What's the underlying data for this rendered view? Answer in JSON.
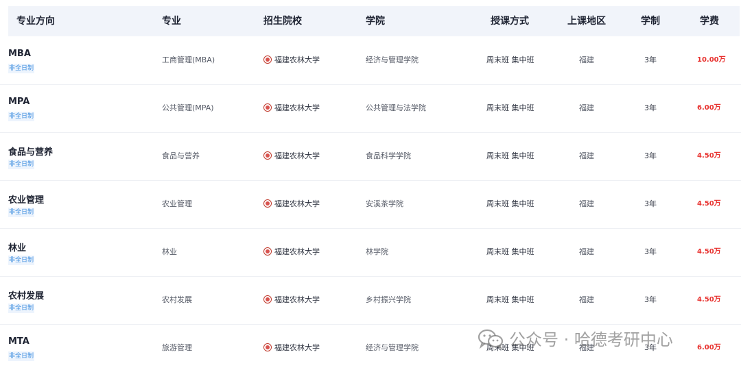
{
  "header": {
    "direction": "专业方向",
    "major": "专业",
    "school": "招生院校",
    "college": "学院",
    "mode": "授课方式",
    "region": "上课地区",
    "years": "学制",
    "fee": "学费"
  },
  "rows": [
    {
      "direction": "MBA",
      "tag": "非全日制",
      "major": "工商管理(MBA)",
      "school": "福建农林大学",
      "college": "经济与管理学院",
      "mode": "周末班 集中班",
      "region": "福建",
      "years": "3年",
      "fee": "10.00万"
    },
    {
      "direction": "MPA",
      "tag": "非全日制",
      "major": "公共管理(MPA)",
      "school": "福建农林大学",
      "college": "公共管理与法学院",
      "mode": "周末班 集中班",
      "region": "福建",
      "years": "3年",
      "fee": "6.00万"
    },
    {
      "direction": "食品与营养",
      "tag": "非全日制",
      "major": "食品与营养",
      "school": "福建农林大学",
      "college": "食品科学学院",
      "mode": "周末班 集中班",
      "region": "福建",
      "years": "3年",
      "fee": "4.50万"
    },
    {
      "direction": "农业管理",
      "tag": "非全日制",
      "major": "农业管理",
      "school": "福建农林大学",
      "college": "安溪茶学院",
      "mode": "周末班 集中班",
      "region": "福建",
      "years": "3年",
      "fee": "4.50万"
    },
    {
      "direction": "林业",
      "tag": "非全日制",
      "major": "林业",
      "school": "福建农林大学",
      "college": "林学院",
      "mode": "周末班 集中班",
      "region": "福建",
      "years": "3年",
      "fee": "4.50万"
    },
    {
      "direction": "农村发展",
      "tag": "非全日制",
      "major": "农村发展",
      "school": "福建农林大学",
      "college": "乡村振兴学院",
      "mode": "周末班 集中班",
      "region": "福建",
      "years": "3年",
      "fee": "4.50万"
    },
    {
      "direction": "MTA",
      "tag": "非全日制",
      "major": "旅游管理",
      "school": "福建农林大学",
      "college": "经济与管理学院",
      "mode": "周末班 集中班",
      "region": "福建",
      "years": "3年",
      "fee": "6.00万"
    }
  ],
  "watermark": {
    "text": "公众号 · 哈德考研中心",
    "icon": "wechat-icon"
  },
  "colors": {
    "header_bg": "#f1f4fa",
    "fee": "#e8322f",
    "tag_text": "#3f8fe0",
    "tag_bg": "#edf4fd",
    "school_logo": "#c0392b"
  }
}
